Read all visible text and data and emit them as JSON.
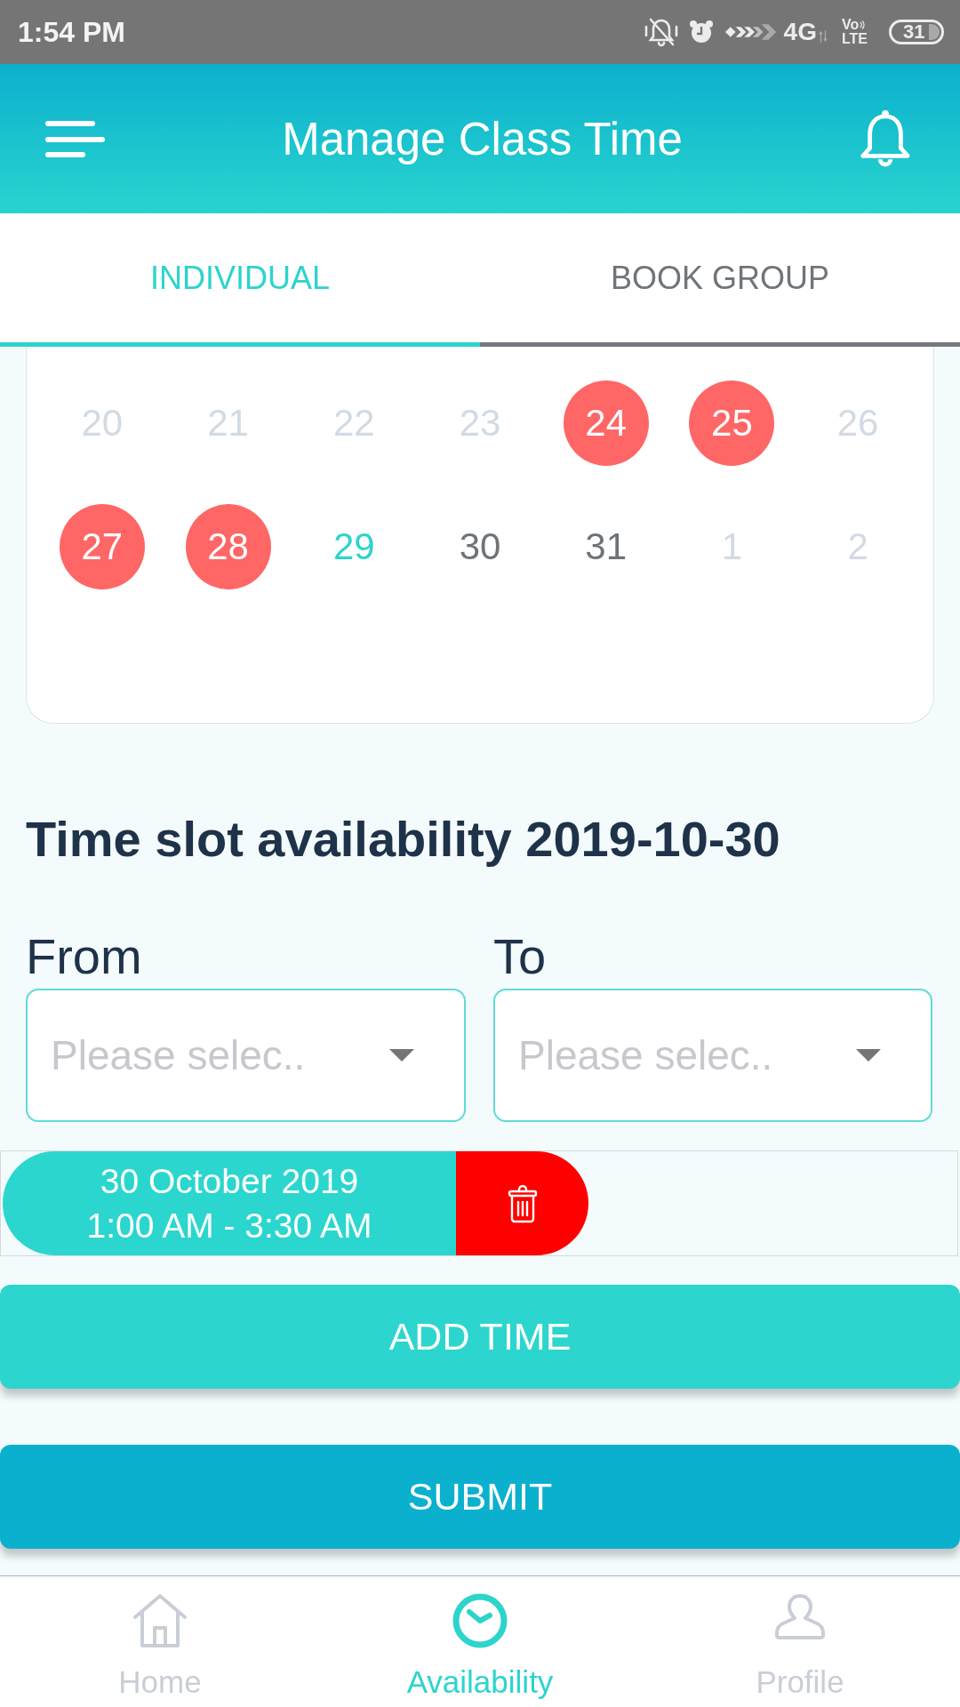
{
  "status_bar": {
    "time": "1:54 PM",
    "network": "4G",
    "volte": {
      "top": "Vo",
      "bottom": "LTE"
    },
    "battery": "31"
  },
  "header": {
    "title": "Manage Class Time"
  },
  "tabs": [
    {
      "label": "INDIVIDUAL",
      "selected": true
    },
    {
      "label": "BOOK GROUP",
      "selected": false
    }
  ],
  "calendar": {
    "weeks": [
      [
        {
          "day": "20",
          "disabled": true,
          "booked": false,
          "today": false
        },
        {
          "day": "21",
          "disabled": true,
          "booked": false,
          "today": false
        },
        {
          "day": "22",
          "disabled": true,
          "booked": false,
          "today": false
        },
        {
          "day": "23",
          "disabled": true,
          "booked": false,
          "today": false
        },
        {
          "day": "24",
          "disabled": false,
          "booked": true,
          "today": false
        },
        {
          "day": "25",
          "disabled": false,
          "booked": true,
          "today": false
        },
        {
          "day": "26",
          "disabled": true,
          "booked": false,
          "today": false
        }
      ],
      [
        {
          "day": "27",
          "disabled": false,
          "booked": true,
          "today": false
        },
        {
          "day": "28",
          "disabled": false,
          "booked": true,
          "today": false
        },
        {
          "day": "29",
          "disabled": false,
          "booked": false,
          "today": true
        },
        {
          "day": "30",
          "disabled": false,
          "booked": false,
          "today": false
        },
        {
          "day": "31",
          "disabled": false,
          "booked": false,
          "today": false
        },
        {
          "day": "1",
          "disabled": true,
          "booked": false,
          "today": false
        },
        {
          "day": "2",
          "disabled": true,
          "booked": false,
          "today": false
        }
      ]
    ]
  },
  "time_slot": {
    "heading": "Time slot availability 2019-10-30",
    "fields": [
      {
        "label": "From",
        "placeholder": "Please selec.."
      },
      {
        "label": "To",
        "placeholder": "Please selec.."
      }
    ],
    "slots": [
      {
        "date": "30 October 2019",
        "time": "1:00 AM - 3:30 AM"
      }
    ]
  },
  "buttons": [
    {
      "label": "ADD TIME",
      "kind": "secondary"
    },
    {
      "label": "SUBMIT",
      "kind": "primary"
    }
  ],
  "bottom_nav": [
    {
      "label": "Home",
      "selected": false
    },
    {
      "label": "Availability",
      "selected": true
    },
    {
      "label": "Profile",
      "selected": false
    }
  ]
}
